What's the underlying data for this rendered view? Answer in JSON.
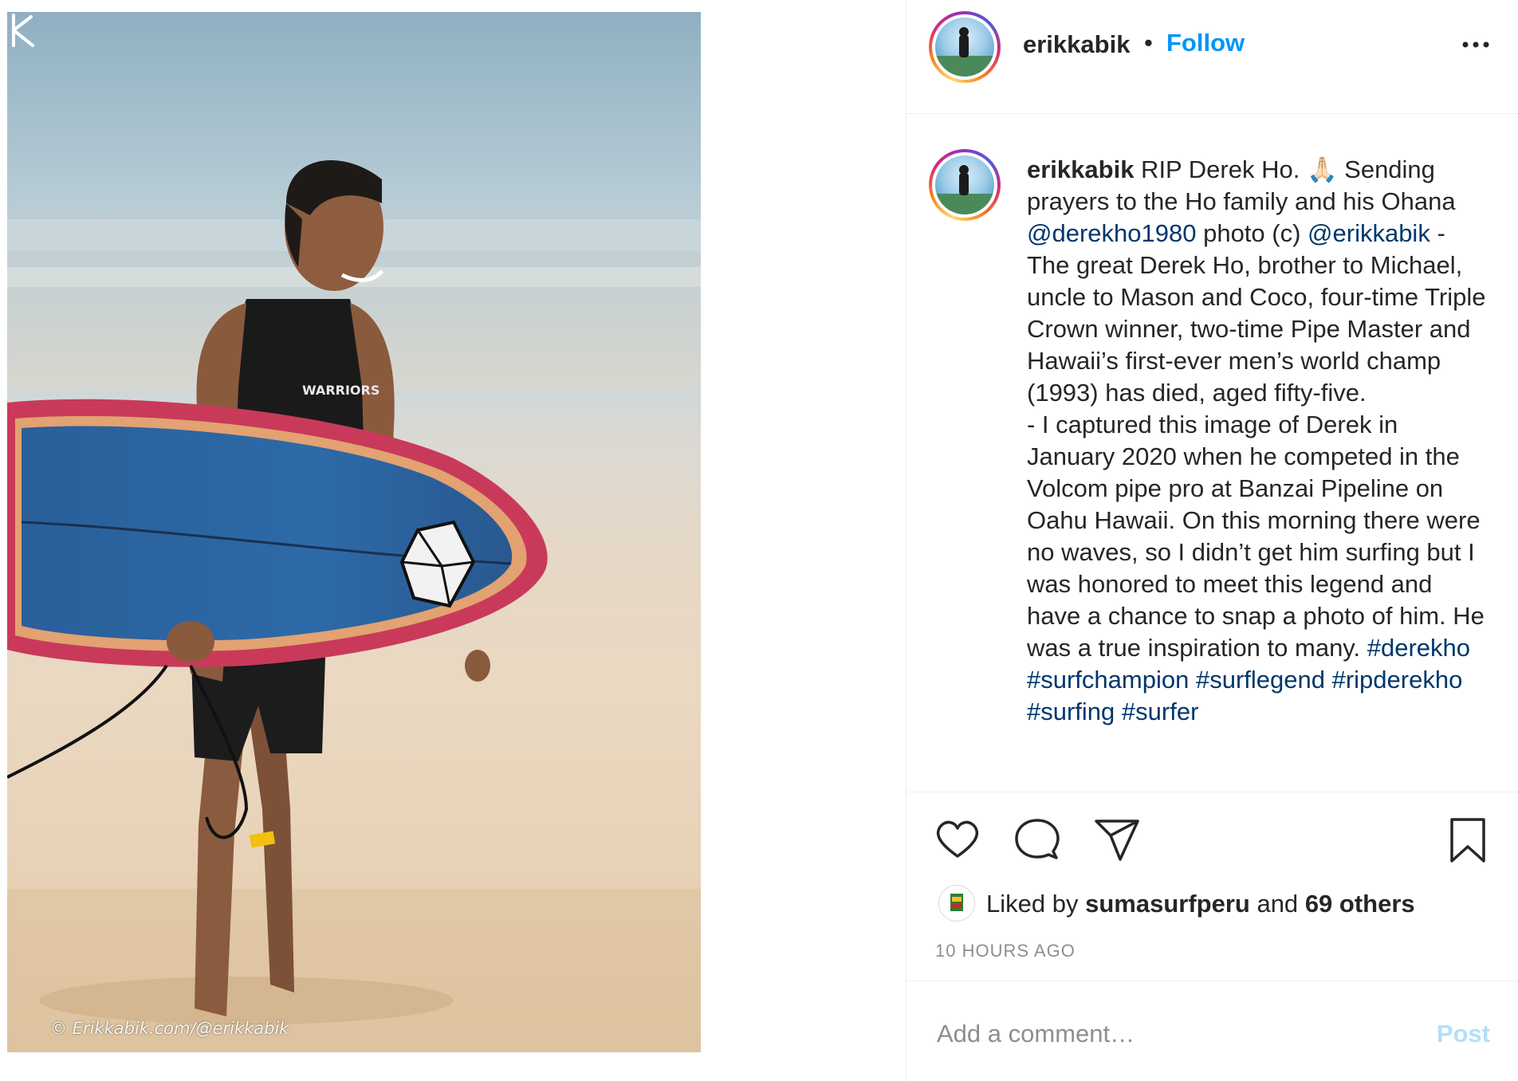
{
  "colors": {
    "accent_blue": "#0095f6",
    "link_blue": "#00376b",
    "post_disabled": "#b2dffc",
    "muted_gray": "#8e8e8e",
    "text": "#262626"
  },
  "photo": {
    "watermark": "© Erikkabik.com/@erikkabik",
    "wetsuit_logo": "WARRIORS"
  },
  "header": {
    "username": "erikkabik",
    "separator": "•",
    "follow_label": "Follow",
    "more_icon": "more-options-icon"
  },
  "caption": {
    "username": "erikkabik",
    "segments": [
      {
        "text": " RIP Derek Ho. 🙏🏻 Sending prayers to the Ho family and his Ohana ",
        "type": "text"
      },
      {
        "text": "@derekho1980",
        "type": "link"
      },
      {
        "text": " photo (c) ",
        "type": "text"
      },
      {
        "text": "@erikkabik",
        "type": "link"
      },
      {
        "text": " - The great Derek Ho, brother to Michael, uncle to Mason and Coco, four-time Triple Crown winner, two-time Pipe Master and Hawaii’s first-ever men’s world champ (1993) has died, aged fifty-five.",
        "type": "text"
      }
    ],
    "paragraph2_text": "- I captured this image of Derek in January 2020 when he competed in the Volcom pipe pro at Banzai Pipeline on Oahu Hawaii. On this morning there were no waves, so I didn’t get him surfing but I was honored to meet this legend and have a chance to snap a photo of him. He was a true inspiration to many.  ",
    "hashtags": [
      "#derekho",
      "#surfchampion",
      "#surflegend",
      "#ripderekho",
      "#surfing",
      "#surfer"
    ]
  },
  "actions": {
    "like_icon": "heart-icon",
    "comment_icon": "comment-icon",
    "share_icon": "share-icon",
    "save_icon": "bookmark-icon"
  },
  "likes": {
    "prefix": "Liked by",
    "liker": "sumasurfperu",
    "and": "and",
    "others": "69 others"
  },
  "timestamp": "10 HOURS AGO",
  "comment": {
    "placeholder": "Add a comment…",
    "post_label": "Post"
  }
}
